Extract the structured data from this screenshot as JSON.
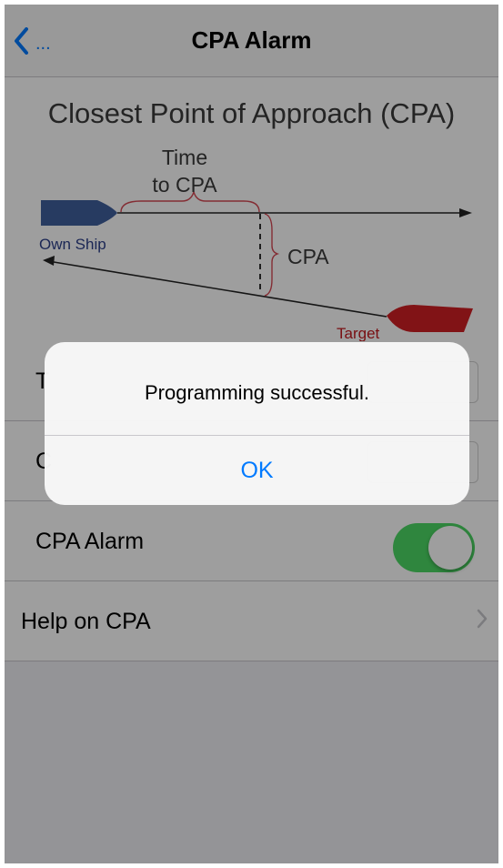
{
  "nav": {
    "back_label": "...",
    "title": "CPA Alarm"
  },
  "diagram": {
    "title": "Closest Point of Approach (CPA)",
    "time_label_line1": "Time",
    "time_label_line2": "to CPA",
    "cpa_label": "CPA",
    "own_ship_label": "Own Ship",
    "target_label": "Target",
    "own_ship_color": "#3f5f9d",
    "target_color": "#d01f24"
  },
  "rows": [
    {
      "label": "T"
    },
    {
      "label": "C"
    },
    {
      "label": "CPA Alarm",
      "toggle_on": true
    },
    {
      "label": "Help on CPA"
    }
  ],
  "alert": {
    "message": "Programming successful.",
    "ok_label": "OK"
  },
  "colors": {
    "accent": "#007aff",
    "toggle_on": "#4cd964"
  }
}
